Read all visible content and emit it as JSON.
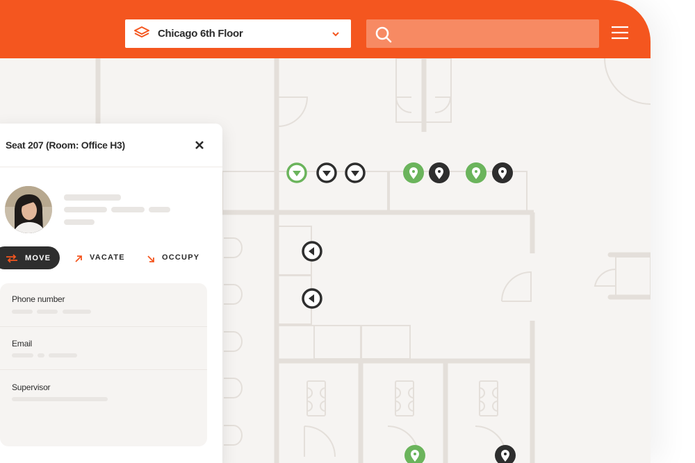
{
  "header": {
    "floor_selector": {
      "value": "Chicago 6th Floor"
    },
    "search": {
      "placeholder": ""
    }
  },
  "seat_panel": {
    "title": "Seat 207 (Room: Office H3)",
    "actions": {
      "move": "MOVE",
      "vacate": "VACATE",
      "occupy": "OCCUPY"
    },
    "fields": [
      {
        "label": "Phone number"
      },
      {
        "label": "Email"
      },
      {
        "label": "Supervisor"
      }
    ]
  },
  "colors": {
    "brand_orange": "#f4561f",
    "search_fill": "#f78a63",
    "pin_green": "#6bb45c",
    "pin_dark": "#2e2e2e",
    "floor_bg": "#f6f4f2",
    "wall": "#e4dfda"
  },
  "icons": {
    "floor_selector": "layers-icon",
    "dropdown": "chevron-down-icon",
    "search": "search-icon",
    "menu": "hamburger-menu-icon",
    "close": "close-icon",
    "move": "swap-arrows-icon",
    "vacate": "arrow-up-right-icon",
    "occupy": "arrow-down-right-icon",
    "seat_markers": "seat-marker-icon"
  }
}
